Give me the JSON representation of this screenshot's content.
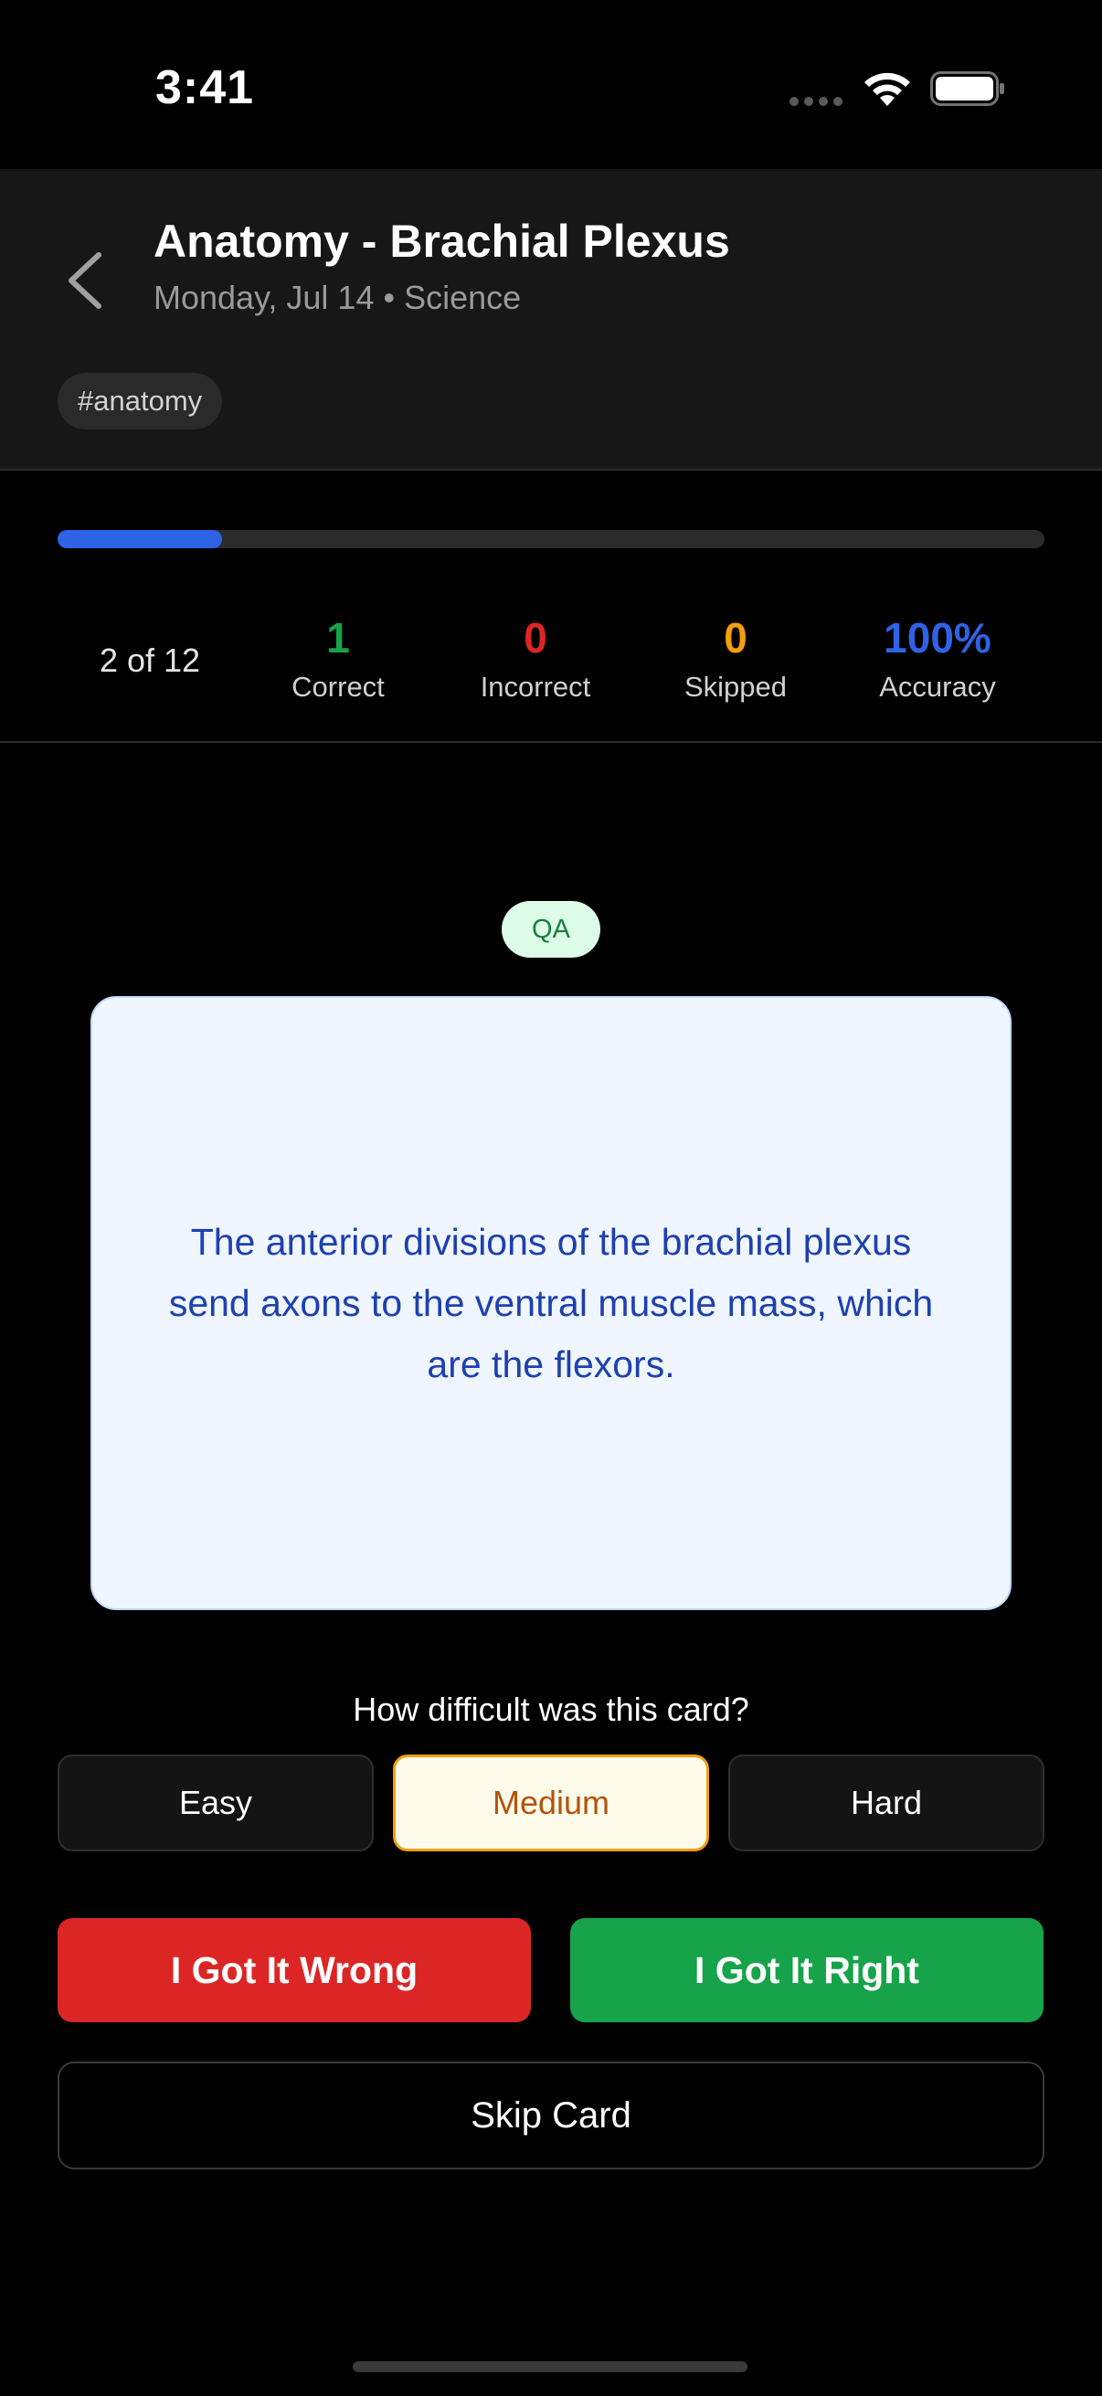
{
  "status_bar": {
    "time": "3:41"
  },
  "header": {
    "title": "Anatomy - Brachial Plexus",
    "subtitle": "Monday, Jul 14 • Science",
    "tag": "#anatomy",
    "back_icon": "chevron-left-icon"
  },
  "progress": {
    "fraction": 0.1667,
    "position_text": "2 of 12",
    "bar_color": "#2f63e6"
  },
  "stats": [
    {
      "value": "1",
      "label": "Correct",
      "color": "#16a34a"
    },
    {
      "value": "0",
      "label": "Incorrect",
      "color": "#dc2626"
    },
    {
      "value": "0",
      "label": "Skipped",
      "color": "#f59e0b"
    },
    {
      "value": "100%",
      "label": "Accuracy",
      "color": "#2f63e6"
    }
  ],
  "card": {
    "type_badge": "QA",
    "text": "The anterior divisions of the brachial plexus send axons to the ventral muscle mass, which are the flexors."
  },
  "difficulty": {
    "question": "How difficult was this card?",
    "options": [
      "Easy",
      "Medium",
      "Hard"
    ],
    "selected": "Medium"
  },
  "actions": {
    "wrong_label": "I Got It Wrong",
    "right_label": "I Got It Right",
    "skip_label": "Skip Card"
  }
}
